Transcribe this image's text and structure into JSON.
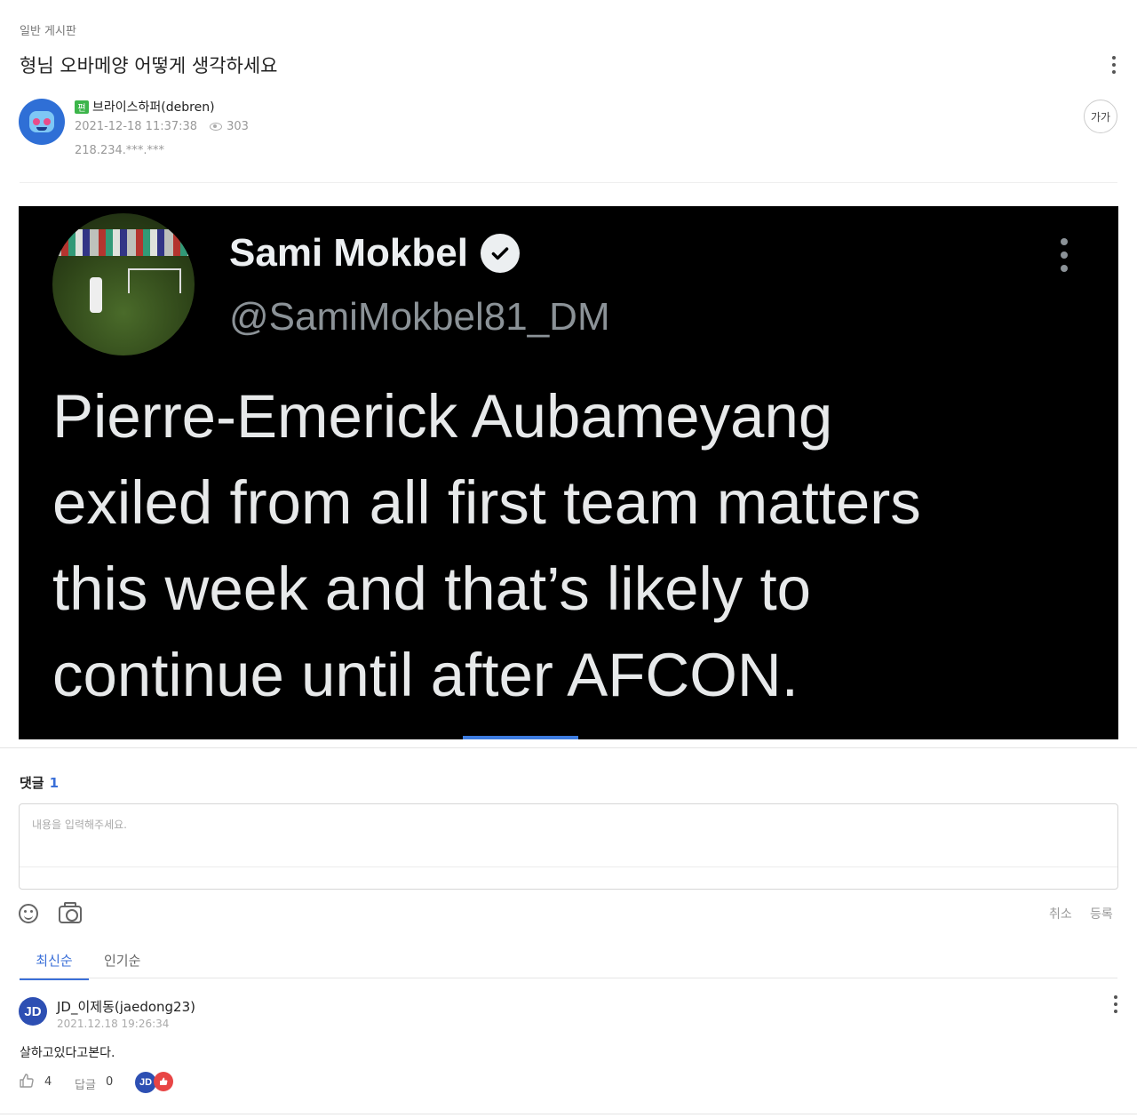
{
  "post": {
    "board": "일반 게시판",
    "title": "형님 오바메양 어떻게 생각하세요",
    "author": "브라이스하퍼(debren)",
    "level_badge": "편",
    "datetime": "2021-12-18 11:37:38",
    "views": "303",
    "ip": "218.234.***.***",
    "font_size_label": "가가"
  },
  "tweet": {
    "name": "Sami Mokbel",
    "handle": "@SamiMokbel81_DM",
    "text": "Pierre-Emerick Aubameyang\nexiled from all first team matters\nthis week and that’s likely to\ncontinue until after AFCON."
  },
  "comments": {
    "label": "댓글",
    "count": "1",
    "input_placeholder": "내용을 입력해주세요.",
    "cancel_label": "취소",
    "submit_label": "등록",
    "sort_tabs": [
      "최신순",
      "인기순"
    ],
    "items": [
      {
        "avatar_text": "JD",
        "author": "JD_이제동(jaedong23)",
        "datetime": "2021.12.18 19:26:34",
        "body": "살하고있다고본다.",
        "likes": "4",
        "reply_label": "답글",
        "reply_count": "0",
        "reactor_avatar_text": "JD"
      }
    ]
  },
  "colors": {
    "accent": "#3a6fd8",
    "level_badge": "#3cb54a",
    "tweet_bg": "#000000"
  }
}
